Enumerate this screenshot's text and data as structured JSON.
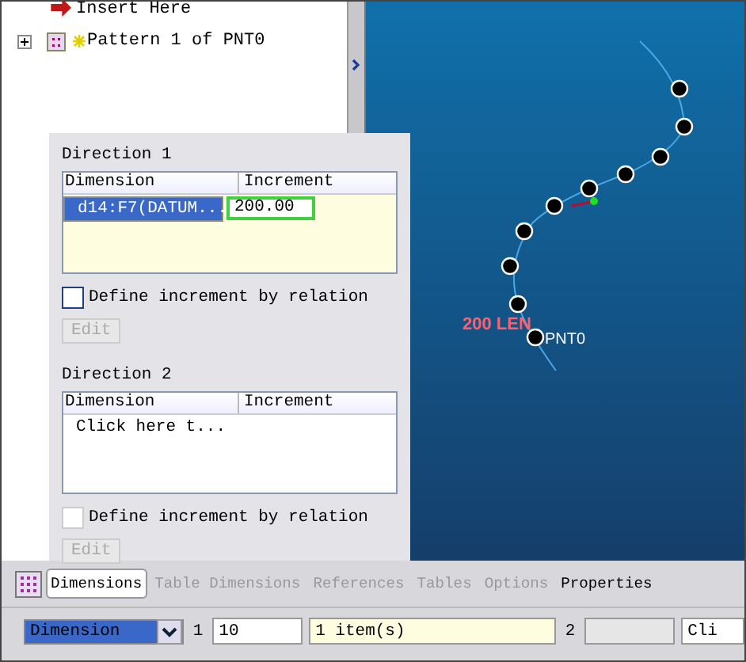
{
  "tree": {
    "items": [
      {
        "label": "Insert Here",
        "kind": "insert"
      },
      {
        "label": "Pattern 1 of PNT0",
        "kind": "pattern",
        "expanded": false
      }
    ]
  },
  "dialog": {
    "directions": [
      {
        "title": "Direction 1",
        "columns": [
          "Dimension",
          "Increment"
        ],
        "rows": [
          {
            "dimension": "d14:F7(DATUM...",
            "increment": "200.00",
            "selected": true
          }
        ],
        "relation_label": "Define increment by relation",
        "relation_checked": false,
        "edit_button": "Edit",
        "edit_disabled": true
      },
      {
        "title": "Direction 2",
        "columns": [
          "Dimension",
          "Increment"
        ],
        "rows": [
          {
            "dimension": "Click here t...",
            "increment": "",
            "selected": false
          }
        ],
        "relation_label": "Define increment by relation",
        "relation_checked": false,
        "edit_button": "Edit",
        "edit_disabled": true
      }
    ]
  },
  "canvas": {
    "dimension_label": "200 LEN",
    "point_label": "PNT0"
  },
  "tabs": [
    {
      "label": "Dimensions",
      "selected": true,
      "disabled": false
    },
    {
      "label": "Table Dimensions",
      "selected": false,
      "disabled": true
    },
    {
      "label": "References",
      "selected": false,
      "disabled": true
    },
    {
      "label": "Tables",
      "selected": false,
      "disabled": true
    },
    {
      "label": "Options",
      "selected": false,
      "disabled": true
    },
    {
      "label": "Properties",
      "selected": false,
      "disabled": false
    }
  ],
  "bottom_bar": {
    "type_select": "Dimension",
    "label_1": "1",
    "count_1": "10",
    "items": "1 item(s)",
    "label_2": "2",
    "cut_field": "Cli"
  }
}
